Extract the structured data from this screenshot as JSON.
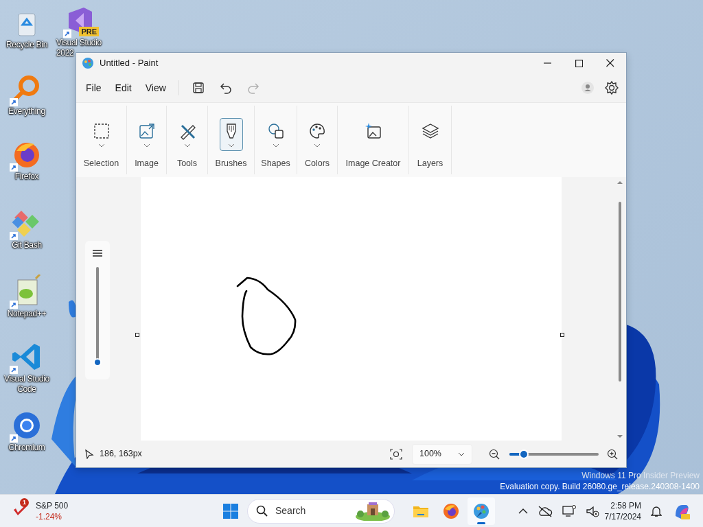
{
  "desktop_icons": [
    {
      "label_lines": [
        "Recycle Bin"
      ],
      "shortcut": false
    },
    {
      "label_lines": [
        "Visual Studio",
        "2022"
      ],
      "shortcut": true,
      "badge": "PRE"
    },
    {
      "label_lines": [
        "Everything"
      ],
      "shortcut": true
    },
    {
      "label_lines": [
        "Firefox"
      ],
      "shortcut": true
    },
    {
      "label_lines": [
        "Git Bash"
      ],
      "shortcut": true
    },
    {
      "label_lines": [
        "Notepad++"
      ],
      "shortcut": true
    },
    {
      "label_lines": [
        "Visual Studio",
        "Code"
      ],
      "shortcut": true
    },
    {
      "label_lines": [
        "Chromium"
      ],
      "shortcut": true
    }
  ],
  "window": {
    "title": "Untitled - Paint"
  },
  "menu": [
    "File",
    "Edit",
    "View"
  ],
  "quick_actions": [
    {
      "kind": "save",
      "disabled": false
    },
    {
      "kind": "undo",
      "disabled": false
    },
    {
      "kind": "redo",
      "disabled": true
    }
  ],
  "ribbon": [
    {
      "label": "Selection",
      "selected": false,
      "dropdown": true
    },
    {
      "label": "Image",
      "selected": false,
      "dropdown": true
    },
    {
      "label": "Tools",
      "selected": false,
      "dropdown": true
    },
    {
      "label": "Brushes",
      "selected": true,
      "dropdown": true
    },
    {
      "label": "Shapes",
      "selected": false,
      "dropdown": true
    },
    {
      "label": "Colors",
      "selected": false,
      "dropdown": true
    },
    {
      "label": "Image Creator",
      "selected": false,
      "dropdown": false
    },
    {
      "label": "Layers",
      "selected": false,
      "dropdown": false
    }
  ],
  "brush_size": {
    "level": 0.02
  },
  "status_bar": {
    "position": "186, 163px",
    "zoom": "100%",
    "zoom_slider": {
      "level": 0.16
    }
  },
  "watermark": [
    "Windows 11 Pro Insider Preview",
    "Evaluation copy. Build 26080.ge_release.240308-1400"
  ],
  "taskbar": {
    "widget": {
      "title": "S&P 500",
      "change": "-1.24%",
      "badge": "1"
    },
    "search": {
      "placeholder": "Search"
    },
    "apps": [
      {
        "kind": "folder",
        "selected": false
      },
      {
        "kind": "browser",
        "selected": false
      },
      {
        "kind": "paint",
        "selected": true
      }
    ],
    "time": "2:58 PM",
    "date": "7/17/2024"
  }
}
